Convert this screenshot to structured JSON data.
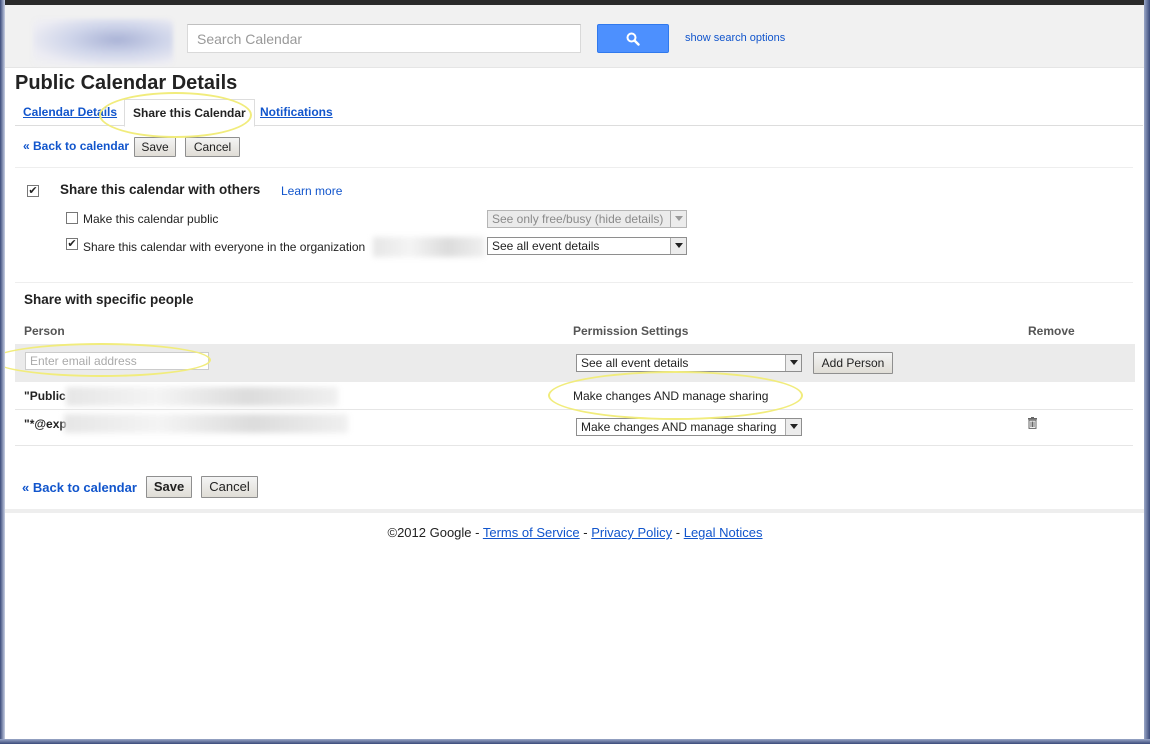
{
  "header": {
    "search_placeholder": "Search Calendar",
    "search_options_link": "show search options"
  },
  "page": {
    "title": "Public Calendar Details"
  },
  "tabs": [
    {
      "label": "Calendar Details",
      "active": false
    },
    {
      "label": "Share this Calendar",
      "active": true
    },
    {
      "label": "Notifications",
      "active": false
    }
  ],
  "actions": {
    "back_label": "« Back to calendar",
    "save_label": "Save",
    "cancel_label": "Cancel"
  },
  "share": {
    "enabled_checked": true,
    "heading": "Share this calendar with others",
    "learn_more": "Learn more",
    "public_option": {
      "label": "Make this calendar public",
      "checked": false,
      "select_value": "See only free/busy (hide details)",
      "disabled": true
    },
    "org_option": {
      "label": "Share this calendar with everyone in the organization",
      "checked": true,
      "select_value": "See all event details"
    }
  },
  "specific": {
    "heading": "Share with specific people",
    "columns": {
      "person": "Person",
      "permission": "Permission Settings",
      "remove": "Remove"
    },
    "email_placeholder": "Enter email address",
    "new_permission": "See all event details",
    "add_person_label": "Add Person",
    "people": [
      {
        "name": "\"Public",
        "permission": "Make changes AND manage sharing",
        "editable": false
      },
      {
        "name": "\"*@exp",
        "permission": "Make changes AND manage sharing",
        "editable": true
      }
    ]
  },
  "footer": {
    "copyright": "©2012 Google - ",
    "sep": " - ",
    "terms": "Terms of Service",
    "privacy": "Privacy Policy",
    "legal": "Legal Notices"
  },
  "colors": {
    "link": "#1155cc",
    "search_button": "#4d90fe",
    "highlight_ellipse": "#f1ec7c",
    "row_band": "#ebebeb"
  },
  "icons": [
    "search-icon",
    "checkmark-icon",
    "dropdown-arrow-icon",
    "trash-icon"
  ]
}
